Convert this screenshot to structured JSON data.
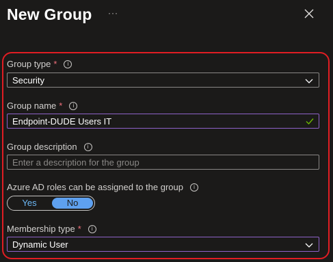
{
  "panel": {
    "title": "New Group",
    "more_label": "···",
    "close_icon": "close-icon"
  },
  "accent_colors": {
    "highlight_frame": "#e11d23",
    "required": "#f1707b",
    "focus_border": "#8f62c9",
    "toggle_selected": "#5ea0ef",
    "valid_check": "#6bb700"
  },
  "form": {
    "group_type": {
      "label": "Group type",
      "required_mark": "*",
      "info": "i",
      "value": "Security"
    },
    "group_name": {
      "label": "Group name",
      "required_mark": "*",
      "info": "i",
      "value": "Endpoint-DUDE Users IT"
    },
    "group_description": {
      "label": "Group description",
      "info": "i",
      "placeholder": "Enter a description for the group"
    },
    "aad_roles": {
      "label": "Azure AD roles can be assigned to the group",
      "info": "i",
      "options": [
        "Yes",
        "No"
      ],
      "selected": "No"
    },
    "membership_type": {
      "label": "Membership type",
      "required_mark": "*",
      "info": "i",
      "value": "Dynamic User"
    }
  }
}
